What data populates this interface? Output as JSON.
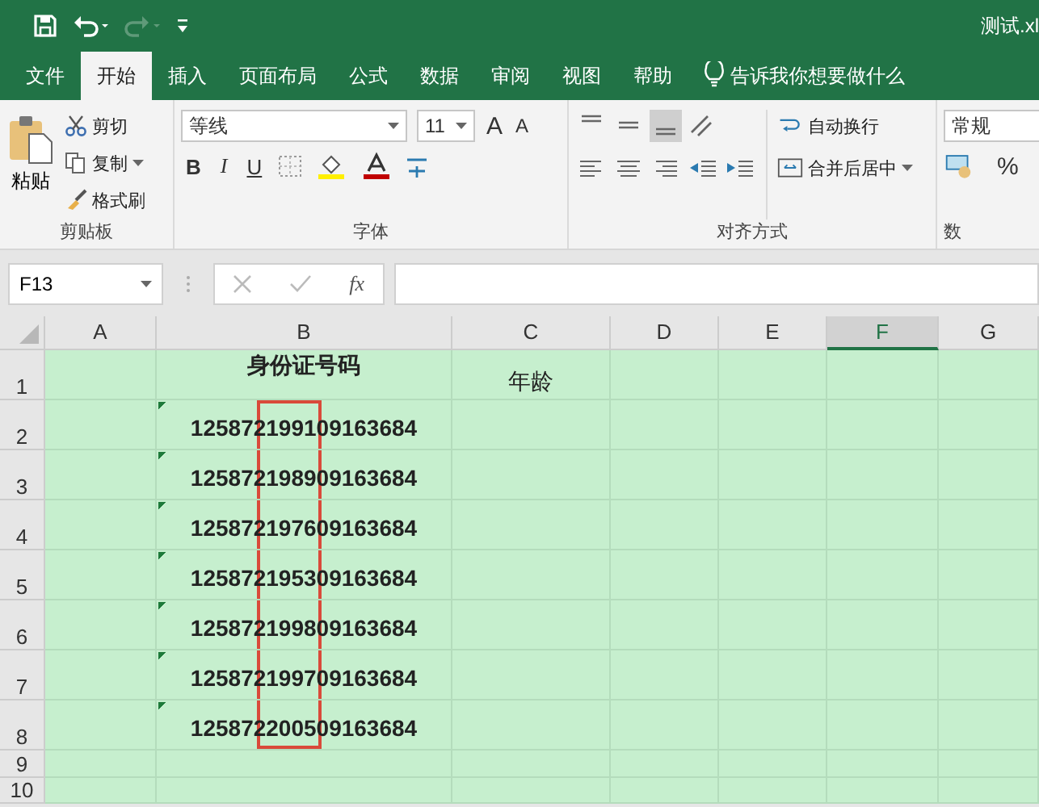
{
  "window": {
    "title": "测试.xl"
  },
  "tabs": [
    {
      "label": "文件",
      "selected": false
    },
    {
      "label": "开始",
      "selected": true
    },
    {
      "label": "插入",
      "selected": false
    },
    {
      "label": "页面布局",
      "selected": false
    },
    {
      "label": "公式",
      "selected": false
    },
    {
      "label": "数据",
      "selected": false
    },
    {
      "label": "审阅",
      "selected": false
    },
    {
      "label": "视图",
      "selected": false
    },
    {
      "label": "帮助",
      "selected": false
    }
  ],
  "tell_me": {
    "text": "告诉我你想要做什么"
  },
  "ribbon": {
    "clipboard": {
      "paste": "粘贴",
      "cut": "剪切",
      "copy": "复制",
      "format_painter": "格式刷",
      "label": "剪贴板"
    },
    "font": {
      "font_name": "等线",
      "font_size": "11",
      "grow": "A",
      "shrink": "A",
      "bold": "B",
      "italic": "I",
      "underline": "U",
      "label": "字体"
    },
    "alignment": {
      "wrap_text": "自动换行",
      "merge_center": "合并后居中",
      "label": "对齐方式"
    },
    "number": {
      "format": "常规",
      "percent": "%",
      "label": "数"
    }
  },
  "formula_bar": {
    "name_box": "F13",
    "function_label": "fx"
  },
  "sheet": {
    "columns": [
      {
        "label": "A",
        "selected": false
      },
      {
        "label": "B",
        "selected": false
      },
      {
        "label": "C",
        "selected": false
      },
      {
        "label": "D",
        "selected": false
      },
      {
        "label": "E",
        "selected": false
      },
      {
        "label": "F",
        "selected": true
      },
      {
        "label": "G",
        "selected": false
      }
    ],
    "rows": [
      {
        "header": "1",
        "b": "身份证号码",
        "c": "年龄",
        "error_flag": false
      },
      {
        "header": "2",
        "b": "125872199109163684",
        "error_flag": true
      },
      {
        "header": "3",
        "b": "125872198909163684",
        "error_flag": true
      },
      {
        "header": "4",
        "b": "125872197609163684",
        "error_flag": true
      },
      {
        "header": "5",
        "b": "125872195309163684",
        "error_flag": true
      },
      {
        "header": "6",
        "b": "125872199809163684",
        "error_flag": true
      },
      {
        "header": "7",
        "b": "125872199709163684",
        "error_flag": true
      },
      {
        "header": "8",
        "b": "125872200509163684",
        "error_flag": true
      },
      {
        "header": "9",
        "error_flag": false
      },
      {
        "header": "10",
        "error_flag": false
      }
    ]
  }
}
